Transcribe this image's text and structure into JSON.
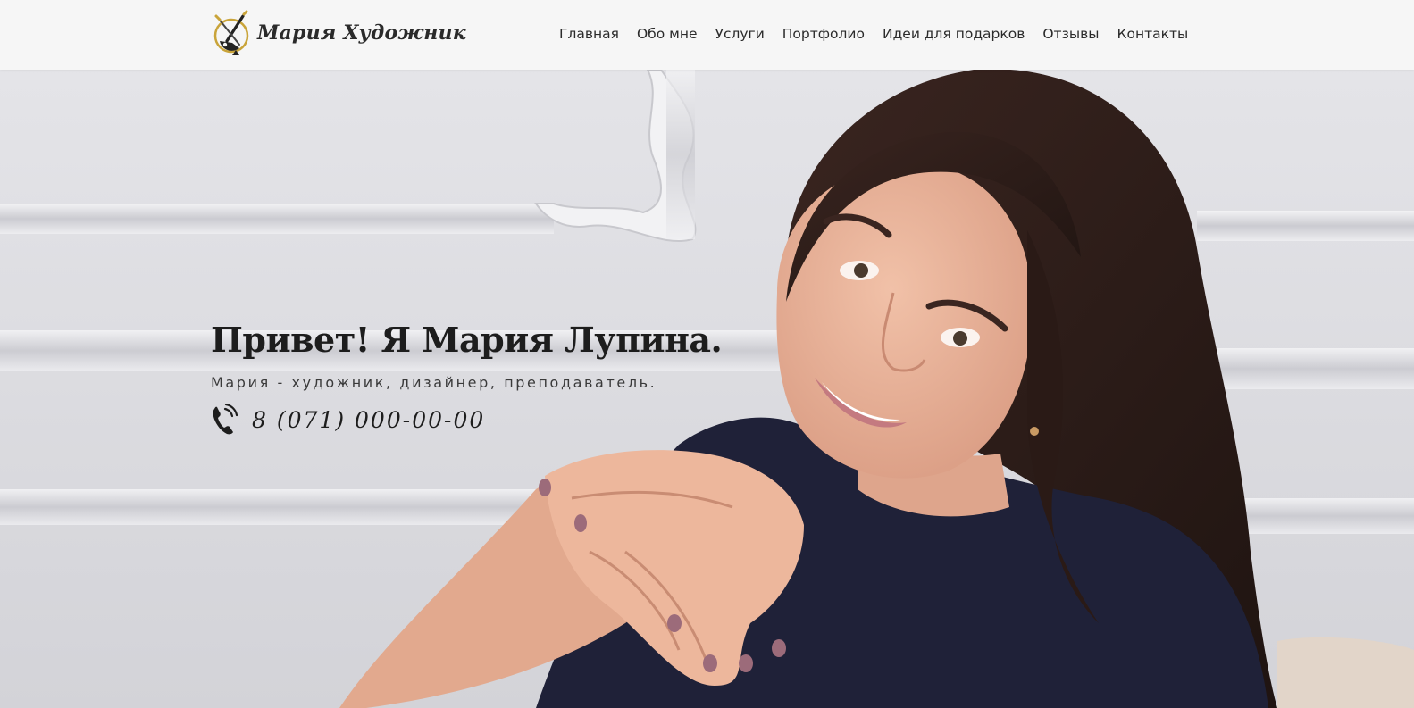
{
  "header": {
    "logo_text": "Мария Художник",
    "nav": [
      {
        "label": "Главная"
      },
      {
        "label": "Обо мне"
      },
      {
        "label": "Услуги"
      },
      {
        "label": "Портфолио"
      },
      {
        "label": "Идеи для подарков"
      },
      {
        "label": "Отзывы"
      },
      {
        "label": "Контакты"
      }
    ]
  },
  "hero": {
    "title": "Привет! Я Мария Лупина.",
    "subtitle": "Мария - художник, дизайнер, преподаватель.",
    "phone": "8 (071) 000-00-00",
    "phone_icon": "phone-icon",
    "background": "portrait-photo"
  },
  "colors": {
    "header_bg": "#f6f6f6",
    "text_dark": "#1d1d1d",
    "logo_gold": "#c9a43a",
    "wall": "#e6e6ea",
    "hair": "#2e1d18",
    "skin": "#e9b29a",
    "top": "#1f2138"
  }
}
